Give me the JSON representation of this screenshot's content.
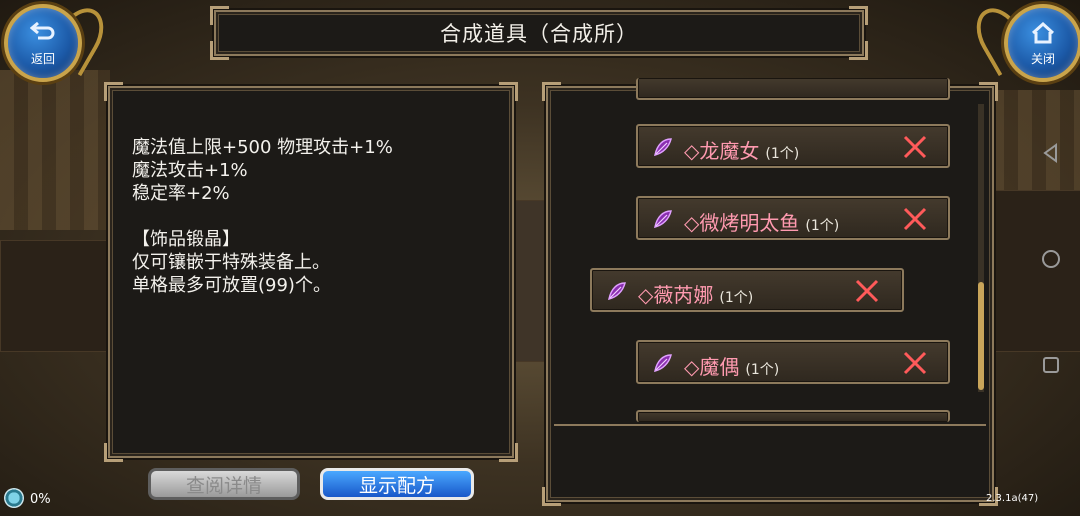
{
  "title": "合成道具（合成所）",
  "nav_buttons": {
    "back_label": "返回",
    "close_label": "关闭"
  },
  "info": {
    "lines": [
      "魔法值上限+500 物理攻击+1%",
      "魔法攻击+1%",
      "稳定率+2%",
      "",
      "【饰品锻晶】",
      "仅可镶嵌于特殊装备上。",
      "单格最多可放置(99)个。"
    ]
  },
  "buttons": {
    "view_details": "查阅详情",
    "show_recipe": "显示配方"
  },
  "list": {
    "items": [
      {
        "name": "◇龙魔女",
        "count": "(1个)"
      },
      {
        "name": "◇微烤明太鱼",
        "count": "(1个)"
      },
      {
        "name": "◇薇芮娜",
        "count": "(1个)",
        "selected": true
      },
      {
        "name": "◇魔偶",
        "count": "(1个)"
      }
    ]
  },
  "status": {
    "percent": "0%",
    "version": "2.3.1a(47)"
  },
  "colors": {
    "item_name": "#ff9ab0",
    "remove_x": "#ff5a5a",
    "frame": "#8d7a5c",
    "accent_blue": "#1857c9"
  },
  "icons": {
    "back": "return-arrow-icon",
    "close": "house-icon",
    "item": "purple-feather-gem-icon",
    "remove": "red-x-icon"
  }
}
